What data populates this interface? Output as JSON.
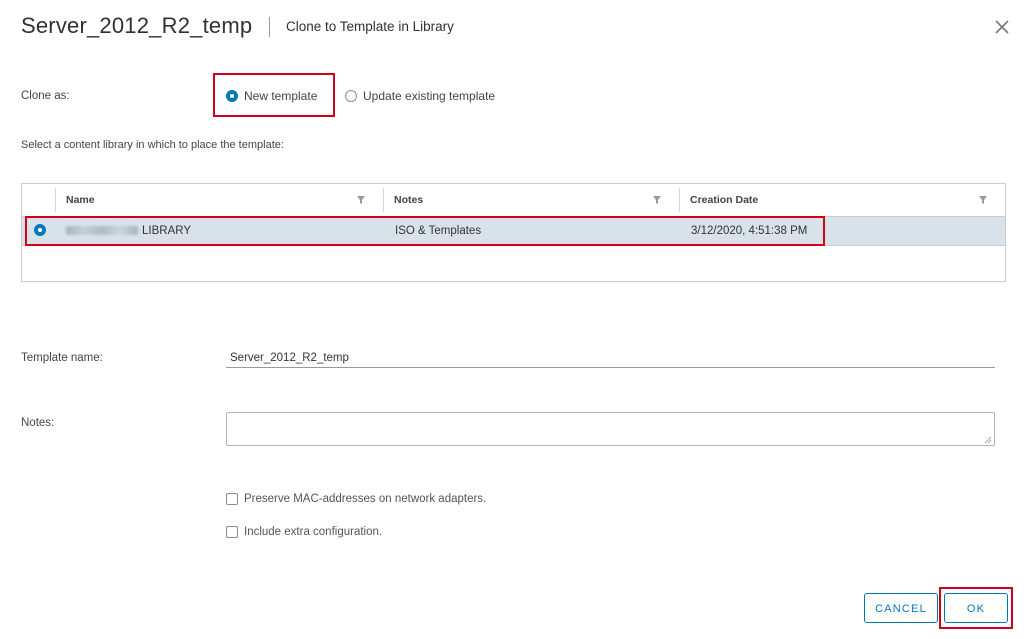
{
  "header": {
    "title": "Server_2012_R2_temp",
    "subtitle": "Clone to Template in Library"
  },
  "clone_as": {
    "label": "Clone as:",
    "options": [
      {
        "label": "New template",
        "selected": true
      },
      {
        "label": "Update existing template",
        "selected": false
      }
    ]
  },
  "library": {
    "instruction": "Select a content library in which to place the template:",
    "columns": [
      "Name",
      "Notes",
      "Creation Date"
    ],
    "rows": [
      {
        "name": "LIBRARY",
        "notes": "ISO & Templates",
        "creation_date": "3/12/2020, 4:51:38 PM",
        "selected": true
      }
    ]
  },
  "template_name": {
    "label": "Template name:",
    "value": "Server_2012_R2_temp"
  },
  "notes": {
    "label": "Notes:",
    "value": ""
  },
  "options": {
    "preserve_mac": "Preserve MAC-addresses on network adapters.",
    "include_extra": "Include extra configuration."
  },
  "buttons": {
    "cancel": "CANCEL",
    "ok": "OK"
  },
  "colors": {
    "accent": "#0079b8",
    "highlight": "#d0021b",
    "selected_row": "#d8e3e9"
  }
}
